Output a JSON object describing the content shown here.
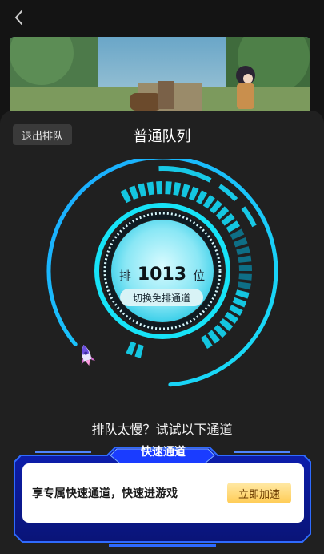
{
  "header": {
    "back_icon": "chevron-left-icon"
  },
  "banner": {
    "image": "anime-scene-girl-in-park"
  },
  "sheet": {
    "exit_label": "退出排队",
    "title": "普通队列"
  },
  "queue": {
    "prefix": "排",
    "position": "1013",
    "suffix": "位",
    "switch_label": "切换免排通道",
    "progress_fraction": 0.85
  },
  "hint": "排队太慢？试试以下通道",
  "fast_channel": {
    "tab_label": "快速通道",
    "description": "享专属快速通道，快速进游戏",
    "button_label": "立即加速"
  },
  "colors": {
    "accent": "#14d6f2",
    "accent_dark": "#0b7fa0",
    "frame_blue": "#1e4cff",
    "button_gold": "#ffcc55"
  }
}
